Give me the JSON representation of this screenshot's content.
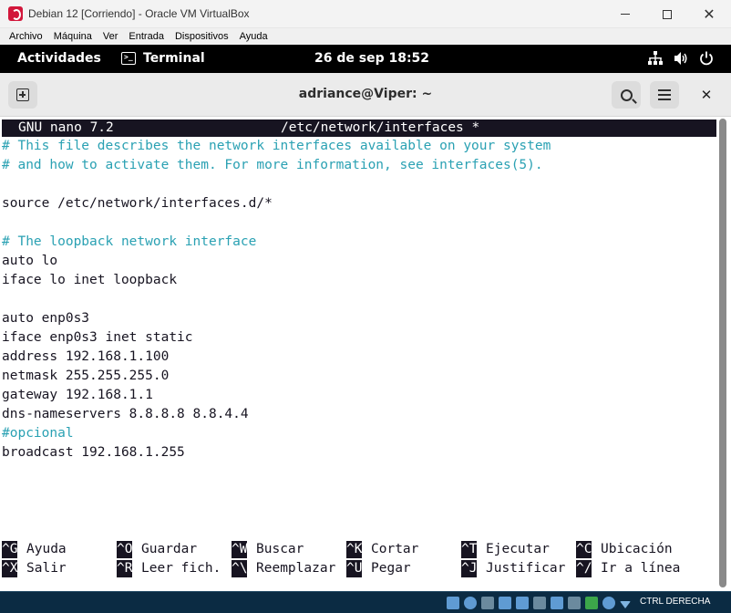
{
  "vbox": {
    "title": "Debian 12  [Corriendo] - Oracle VM VirtualBox",
    "menu": [
      "Archivo",
      "Máquina",
      "Ver",
      "Entrada",
      "Dispositivos",
      "Ayuda"
    ],
    "host_key": "CTRL DERECHA"
  },
  "gnome": {
    "activities": "Actividades",
    "app_name": "Terminal",
    "clock": "26 de sep  18:52"
  },
  "terminal": {
    "title": "adriance@Viper: ~"
  },
  "nano": {
    "version": "GNU nano 7.2",
    "file": "/etc/network/interfaces *",
    "lines": [
      {
        "text": "# This file describes the network interfaces available on your system",
        "comment": true
      },
      {
        "text": "# and how to activate them. For more information, see interfaces(5).",
        "comment": true
      },
      {
        "text": "",
        "comment": false
      },
      {
        "text": "source /etc/network/interfaces.d/*",
        "comment": false
      },
      {
        "text": "",
        "comment": false
      },
      {
        "text": "# The loopback network interface",
        "comment": true
      },
      {
        "text": "auto lo",
        "comment": false
      },
      {
        "text": "iface lo inet loopback",
        "comment": false
      },
      {
        "text": "",
        "comment": false
      },
      {
        "text": "auto enp0s3",
        "comment": false
      },
      {
        "text": "iface enp0s3 inet static",
        "comment": false
      },
      {
        "text": "address 192.168.1.100",
        "comment": false
      },
      {
        "text": "netmask 255.255.255.0",
        "comment": false
      },
      {
        "text": "gateway 192.168.1.1",
        "comment": false
      },
      {
        "text": "dns-nameservers 8.8.8.8 8.8.4.4",
        "comment": false
      },
      {
        "text": "#opcional",
        "comment": true
      },
      {
        "text": "broadcast 192.168.1.255",
        "comment": false
      }
    ],
    "shortcuts_row1": [
      {
        "key": "^G",
        "label": "Ayuda"
      },
      {
        "key": "^O",
        "label": "Guardar"
      },
      {
        "key": "^W",
        "label": "Buscar"
      },
      {
        "key": "^K",
        "label": "Cortar"
      },
      {
        "key": "^T",
        "label": "Ejecutar"
      },
      {
        "key": "^C",
        "label": "Ubicación"
      }
    ],
    "shortcuts_row2": [
      {
        "key": "^X",
        "label": "Salir"
      },
      {
        "key": "^R",
        "label": "Leer fich."
      },
      {
        "key": "^\\",
        "label": "Reemplazar"
      },
      {
        "key": "^U",
        "label": "Pegar"
      },
      {
        "key": "^J",
        "label": "Justificar"
      },
      {
        "key": "^/",
        "label": "Ir a línea"
      }
    ]
  },
  "colors": {
    "comment": "#2aa1b3",
    "terminal_fg": "#171421",
    "gnome_bar": "#000000",
    "status_bar": "#0b2b43"
  }
}
